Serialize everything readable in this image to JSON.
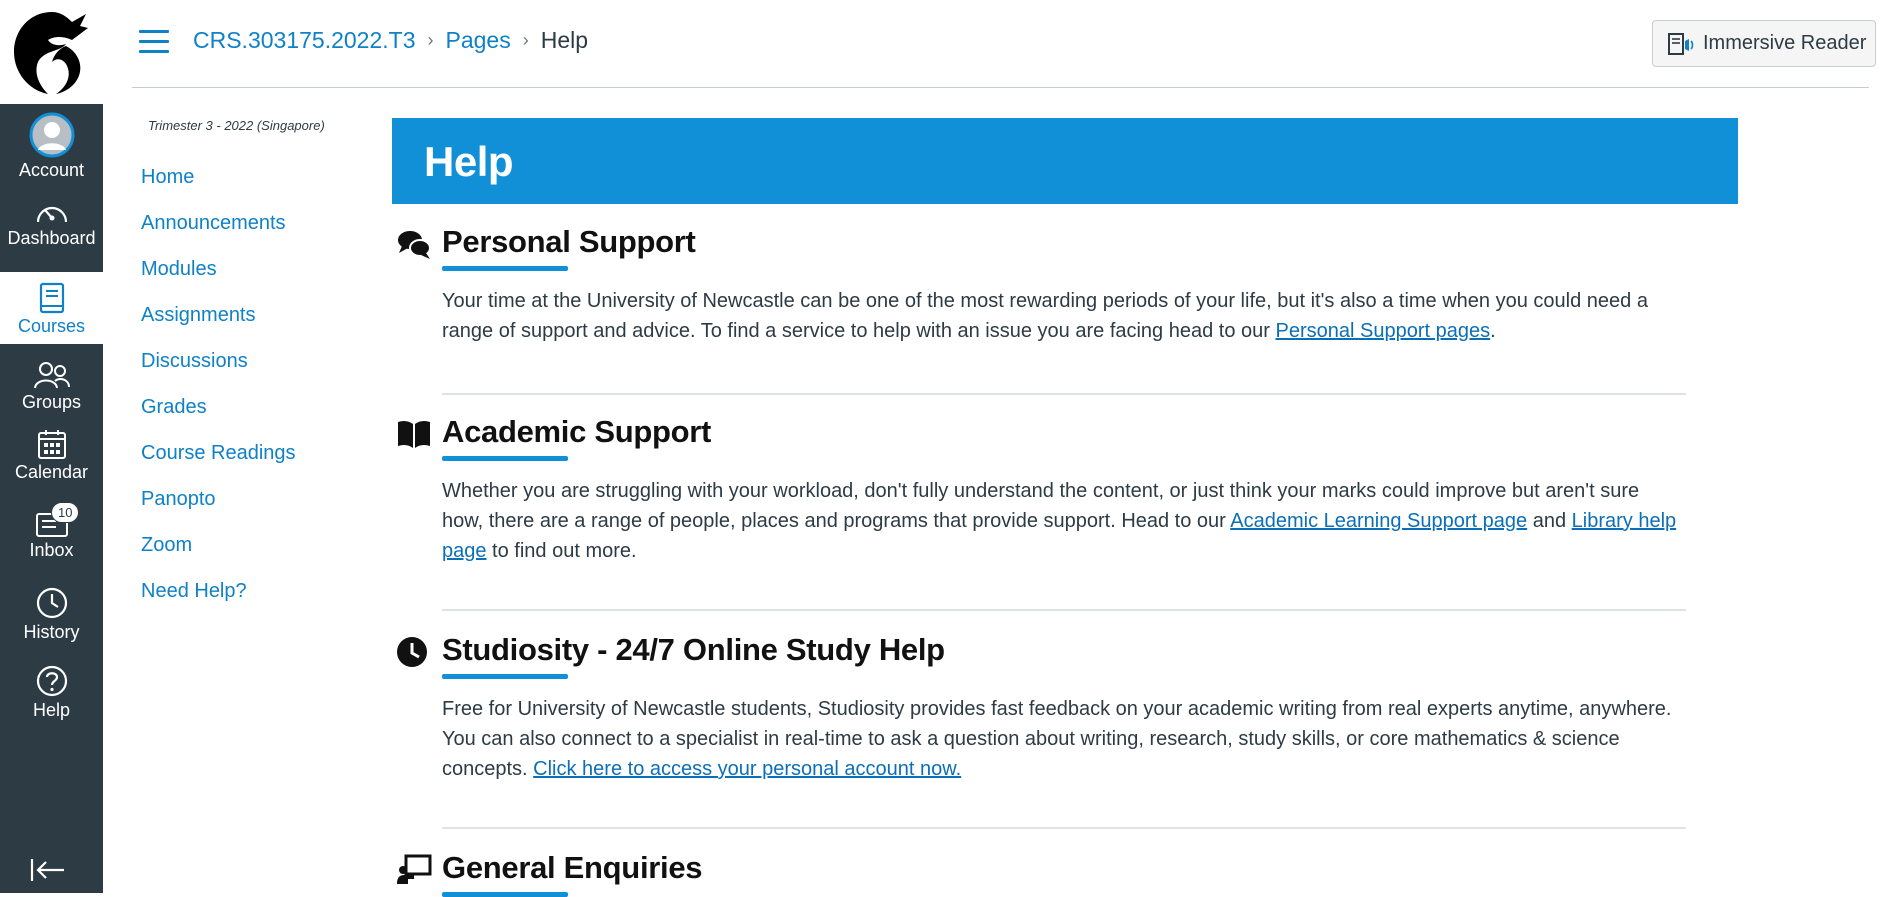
{
  "global_nav": {
    "items": [
      {
        "label": "Account"
      },
      {
        "label": "Dashboard"
      },
      {
        "label": "Courses"
      },
      {
        "label": "Groups"
      },
      {
        "label": "Calendar"
      },
      {
        "label": "Inbox",
        "badge": "10"
      },
      {
        "label": "History"
      },
      {
        "label": "Help"
      }
    ]
  },
  "header": {
    "breadcrumb": [
      "CRS.303175.2022.T3",
      "Pages",
      "Help"
    ],
    "immersive_reader": "Immersive Reader"
  },
  "course_nav": {
    "term": "Trimester 3 - 2022 (Singapore)",
    "items": [
      "Home",
      "Announcements",
      "Modules",
      "Assignments",
      "Discussions",
      "Grades",
      "Course Readings",
      "Panopto",
      "Zoom",
      "Need Help?"
    ]
  },
  "page": {
    "title": "Help",
    "sections": [
      {
        "title": "Personal Support",
        "body_pre": "Your time at the University of Newcastle can be one of the most rewarding periods of your life, but it's also a time when you could need a range of support and advice. To find a service to help with an issue you are facing head to our ",
        "link1": "Personal Support pages",
        "body_post": "."
      },
      {
        "title": "Academic Support",
        "body_pre": "Whether you are struggling with your workload, don't fully understand the content, or just think your marks could improve but aren't sure how, there are a range of people, places and programs that provide support. Head to our ",
        "link1": "Academic Learning Support page",
        "body_mid": " and ",
        "link2": "Library help page",
        "body_post": " to find out more."
      },
      {
        "title": "Studiosity - 24/7 Online Study Help",
        "body_pre": "Free for University of Newcastle students, Studiosity provides fast feedback on your academic writing from real experts anytime, anywhere. You can also connect to a specialist in real-time to ask a question about writing, research, study skills, or core mathematics & science concepts. ",
        "link1": "Click here to access your personal account now."
      },
      {
        "title": "General Enquiries"
      }
    ]
  },
  "colors": {
    "nav_bg": "#2d3b45",
    "link": "#0f81c7",
    "banner": "#1190d7"
  },
  "icons": [
    "logo-icon",
    "avatar-icon",
    "dashboard-icon",
    "courses-icon",
    "groups-icon",
    "calendar-icon",
    "inbox-icon",
    "history-icon",
    "help-icon",
    "collapse-icon",
    "hamburger-icon",
    "immersive-reader-icon",
    "comments-icon",
    "book-icon",
    "clock-icon",
    "chalkboard-icon"
  ]
}
